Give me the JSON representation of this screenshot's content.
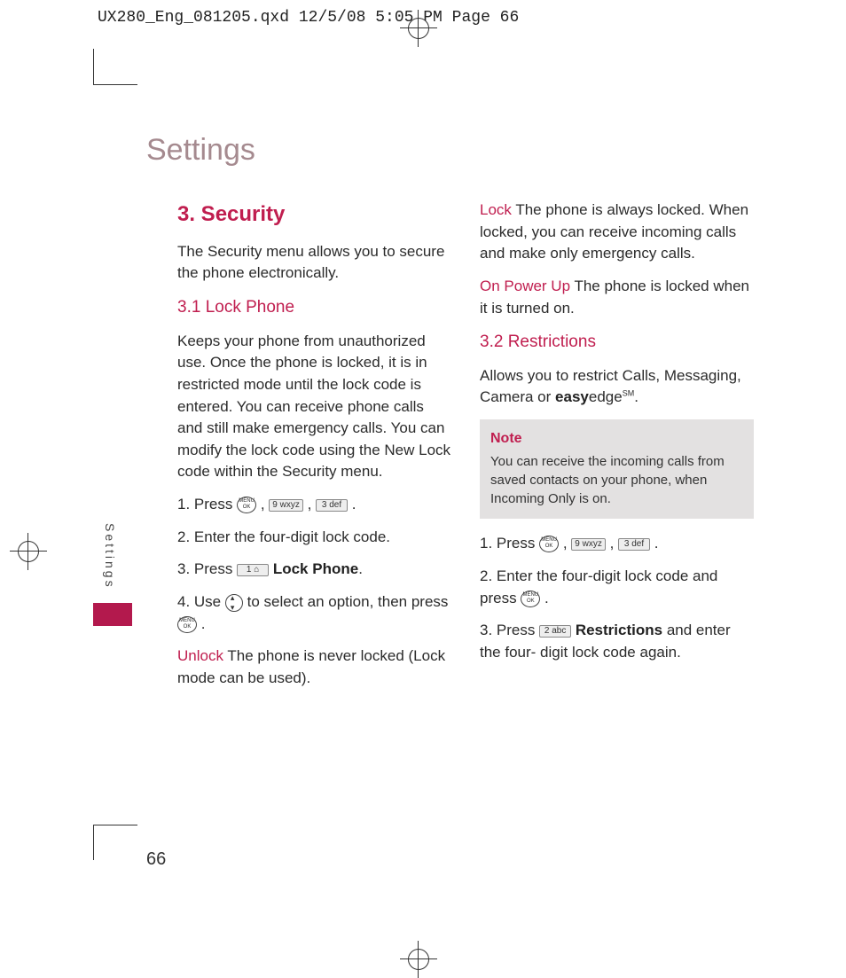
{
  "print_header": "UX280_Eng_081205.qxd  12/5/08  5:05 PM  Page 66",
  "chapter_title": "Settings",
  "side_tab": "Settings",
  "page_number": "66",
  "keys": {
    "ok": "MENU\nOK",
    "k9": "9 wxyz",
    "k3": "3 def",
    "k1": "1 ⌂",
    "k2": "2 abc"
  },
  "sec": {
    "title": "3. Security",
    "intro": "The Security menu allows you to secure the phone electronically.",
    "s31_title": "3.1 Lock Phone",
    "s31_body": "Keeps your phone from unauthorized use. Once the phone is locked, it is in restricted mode until the lock code is entered. You can receive phone calls and still make emergency calls. You can modify the lock code using the New Lock code within the Security menu.",
    "s31_step1": "1. Press ",
    "s31_step2": "2. Enter the four-digit lock code.",
    "s31_step3a": "3. Press ",
    "s31_step3b": " Lock Phone",
    "s31_step4a": "4. Use ",
    "s31_step4b": " to select an option, then press ",
    "unlock_label": "Unlock",
    "unlock_body": "  The phone is never locked (Lock mode can be used).",
    "lock_label": "Lock",
    "lock_body": " The phone is always locked. When locked, you can receive incoming calls and make only emergency calls.",
    "onpower_label": "On Power Up",
    "onpower_body": "  The phone is locked when it is turned on.",
    "s32_title": "3.2 Restrictions",
    "s32_body_a": "Allows you to restrict Calls, Messaging, Camera or ",
    "s32_body_b": "easy",
    "s32_body_c": "edge",
    "s32_body_d": ".",
    "note_title": "Note",
    "note_body": "You can receive the incoming calls from saved contacts on your phone, when Incoming Only is on.",
    "s32_step1": "1. Press ",
    "s32_step2a": "2. Enter the four-digit lock code and press ",
    "s32_step3a": "3. Press ",
    "s32_step3b": " Restrictions",
    "s32_step3c": " and enter the four- digit lock code again.",
    "comma": " , ",
    "period": " ."
  }
}
